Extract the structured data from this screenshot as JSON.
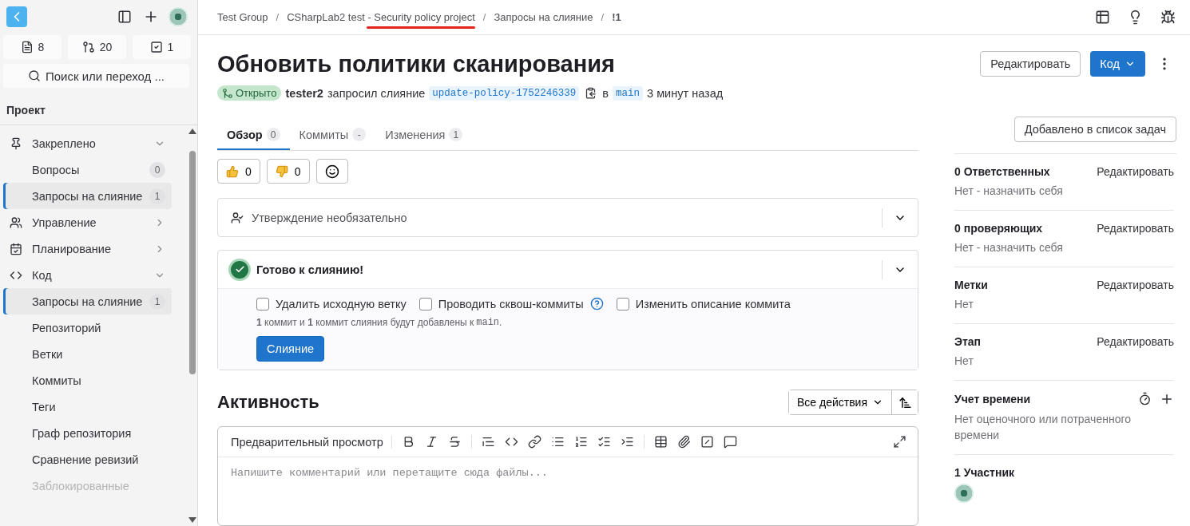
{
  "sidebar": {
    "counters": [
      {
        "kind": "issues",
        "count": "8"
      },
      {
        "kind": "merge_requests",
        "count": "20"
      },
      {
        "kind": "todos",
        "count": "1"
      }
    ],
    "search": {
      "placeholder": "Поиск или переход ..."
    },
    "section_title": "Проект",
    "items": [
      {
        "kind": "pinned",
        "label": "Закреплено",
        "expanded": true,
        "children": [
          {
            "label": "Вопросы",
            "badge": "0",
            "selected": false
          },
          {
            "label": "Запросы на слияние",
            "badge": "1",
            "selected": true
          }
        ]
      },
      {
        "kind": "manage",
        "label": "Управление",
        "expanded": false
      },
      {
        "kind": "plan",
        "label": "Планирование",
        "expanded": false
      },
      {
        "kind": "code",
        "label": "Код",
        "expanded": true,
        "children": [
          {
            "label": "Запросы на слияние",
            "badge": "1",
            "selected": true
          },
          {
            "label": "Репозиторий",
            "selected": false
          },
          {
            "label": "Ветки",
            "selected": false
          },
          {
            "label": "Коммиты",
            "selected": false
          },
          {
            "label": "Теги",
            "selected": false
          },
          {
            "label": "Граф репозитория",
            "selected": false
          },
          {
            "label": "Сравнение ревизий",
            "selected": false
          },
          {
            "label": "Заблокированные",
            "selected": false,
            "disabled": true
          }
        ]
      }
    ]
  },
  "breadcrumb": [
    "Test Group",
    "CSharpLab2 test - Security policy project",
    "Запросы на слияние",
    "!1"
  ],
  "breadcrumb_separator": "/",
  "title": "Обновить политики сканирования",
  "meta": {
    "status": "Открыто",
    "author": "tester2",
    "action": "запросил слияние",
    "source_branch": "update-policy-1752246339",
    "into": "в",
    "target_branch": "main",
    "time": "3 минут назад"
  },
  "header_buttons": {
    "edit": "Редактировать",
    "code": "Код"
  },
  "tabs": [
    {
      "label": "Обзор",
      "count": "0",
      "selected": true
    },
    {
      "label": "Коммиты",
      "count": "-",
      "selected": false
    },
    {
      "label": "Изменения",
      "count": "1",
      "selected": false
    }
  ],
  "todo_button": "Добавлено в список задач",
  "reactions": [
    {
      "kind": "thumbs_up",
      "count": "0"
    },
    {
      "kind": "thumbs_down",
      "count": "0"
    }
  ],
  "approval": {
    "label": "Утверждение необязательно",
    "expanded": false
  },
  "merge": {
    "title": "Готово к слиянию!",
    "expanded": true,
    "options": [
      {
        "label": "Удалить исходную ветку",
        "checked": false,
        "help": false
      },
      {
        "label": "Проводить сквош-коммиты",
        "checked": false,
        "help": true
      },
      {
        "label": "Изменить описание коммита",
        "checked": false,
        "help": false
      }
    ],
    "note": "**1** коммит и **1** коммит слияния будут добавлены к",
    "note_branch": "main",
    "note_end": ".",
    "button": "Слияние"
  },
  "activity": {
    "title": "Активность",
    "filter": "Все действия",
    "editor_tab": "Предварительный просмотр",
    "placeholder": "Напишите комментарий или перетащите сюда файлы..."
  },
  "right_sidebar": {
    "blocks": [
      {
        "title": "0 Ответственных",
        "action": "Редактировать",
        "value": "Нет - назначить себя"
      },
      {
        "title": "0 проверяющих",
        "action": "Редактировать",
        "value": "Нет - назначить себя"
      },
      {
        "title": "Метки",
        "action": "Редактировать",
        "value": "Нет"
      },
      {
        "title": "Этап",
        "action": "Редактировать",
        "value": "Нет"
      }
    ],
    "time_tracking": {
      "title": "Учет времени",
      "value": "Нет оценочного или потраченного времени"
    },
    "participants": {
      "title": "1 Участник"
    }
  }
}
